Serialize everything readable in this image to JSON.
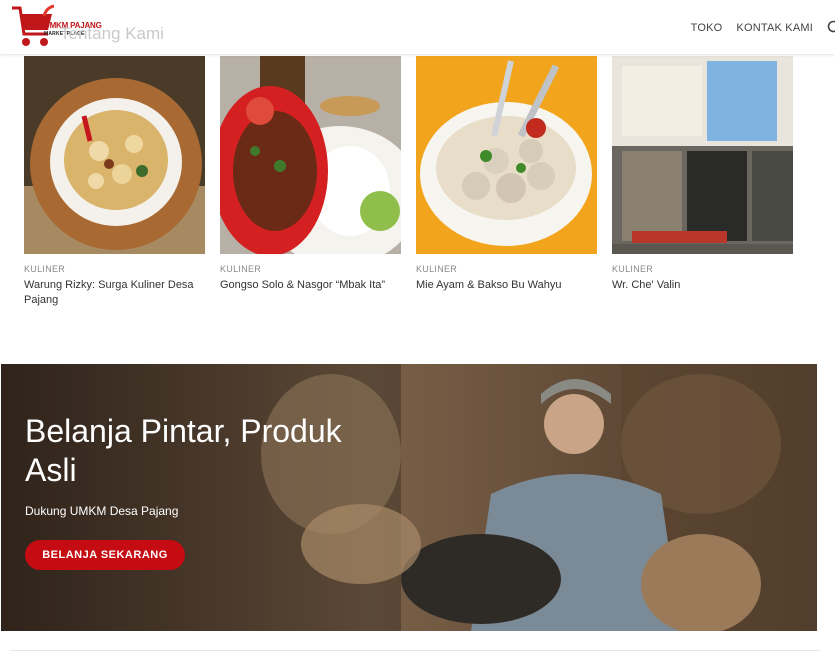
{
  "header": {
    "logo_title": "UMKM PAJANG",
    "logo_subtitle": "MARKETPLACE",
    "ghost_title": "Tentang Kami",
    "nav": [
      "TOKO",
      "KONTAK KAMI"
    ]
  },
  "cards": [
    {
      "category": "KULINER",
      "title": "Warung Rizky: Surga Kuliner Desa Pajang"
    },
    {
      "category": "KULINER",
      "title": "Gongso Solo & Nasgor “Mbak Ita”"
    },
    {
      "category": "KULINER",
      "title": "Mie Ayam & Bakso Bu Wahyu"
    },
    {
      "category": "KULINER",
      "title": "Wr. Che' Valin"
    }
  ],
  "hero": {
    "title": "Belanja Pintar, Produk Asli",
    "subtitle": "Dukung UMKM Desa Pajang",
    "button_label": "BELANJA SEKARANG"
  },
  "colors": {
    "brand": "#c40c12"
  }
}
